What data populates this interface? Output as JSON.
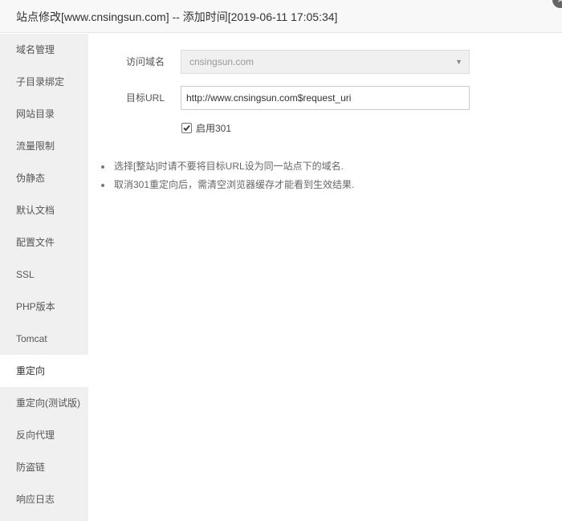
{
  "window": {
    "title": "站点修改[www.cnsingsun.com] -- 添加时间[2019-06-11 17:05:34]",
    "close_symbol": "×"
  },
  "sidebar": {
    "items": [
      {
        "label": "域名管理"
      },
      {
        "label": "子目录绑定"
      },
      {
        "label": "网站目录"
      },
      {
        "label": "流量限制"
      },
      {
        "label": "伪静态"
      },
      {
        "label": "默认文档"
      },
      {
        "label": "配置文件"
      },
      {
        "label": "SSL"
      },
      {
        "label": "PHP版本"
      },
      {
        "label": "Tomcat"
      },
      {
        "label": "重定向",
        "active": true
      },
      {
        "label": "重定向(测试版)"
      },
      {
        "label": "反向代理"
      },
      {
        "label": "防盗链"
      },
      {
        "label": "响应日志"
      }
    ]
  },
  "form": {
    "domain_label": "访问域名",
    "domain_value": "cnsingsun.com",
    "target_label": "目标URL",
    "target_value": "http://www.cnsingsun.com$request_uri",
    "enable_label": "启用301",
    "enable_checked": true
  },
  "tips": [
    "选择[整站]时请不要将目标URL设为同一站点下的域名.",
    "取消301重定向后，需清空浏览器缓存才能看到生效结果."
  ],
  "icons": {
    "close": "close-icon",
    "dropdown": "chevron-down-icon",
    "check": "check-icon"
  }
}
